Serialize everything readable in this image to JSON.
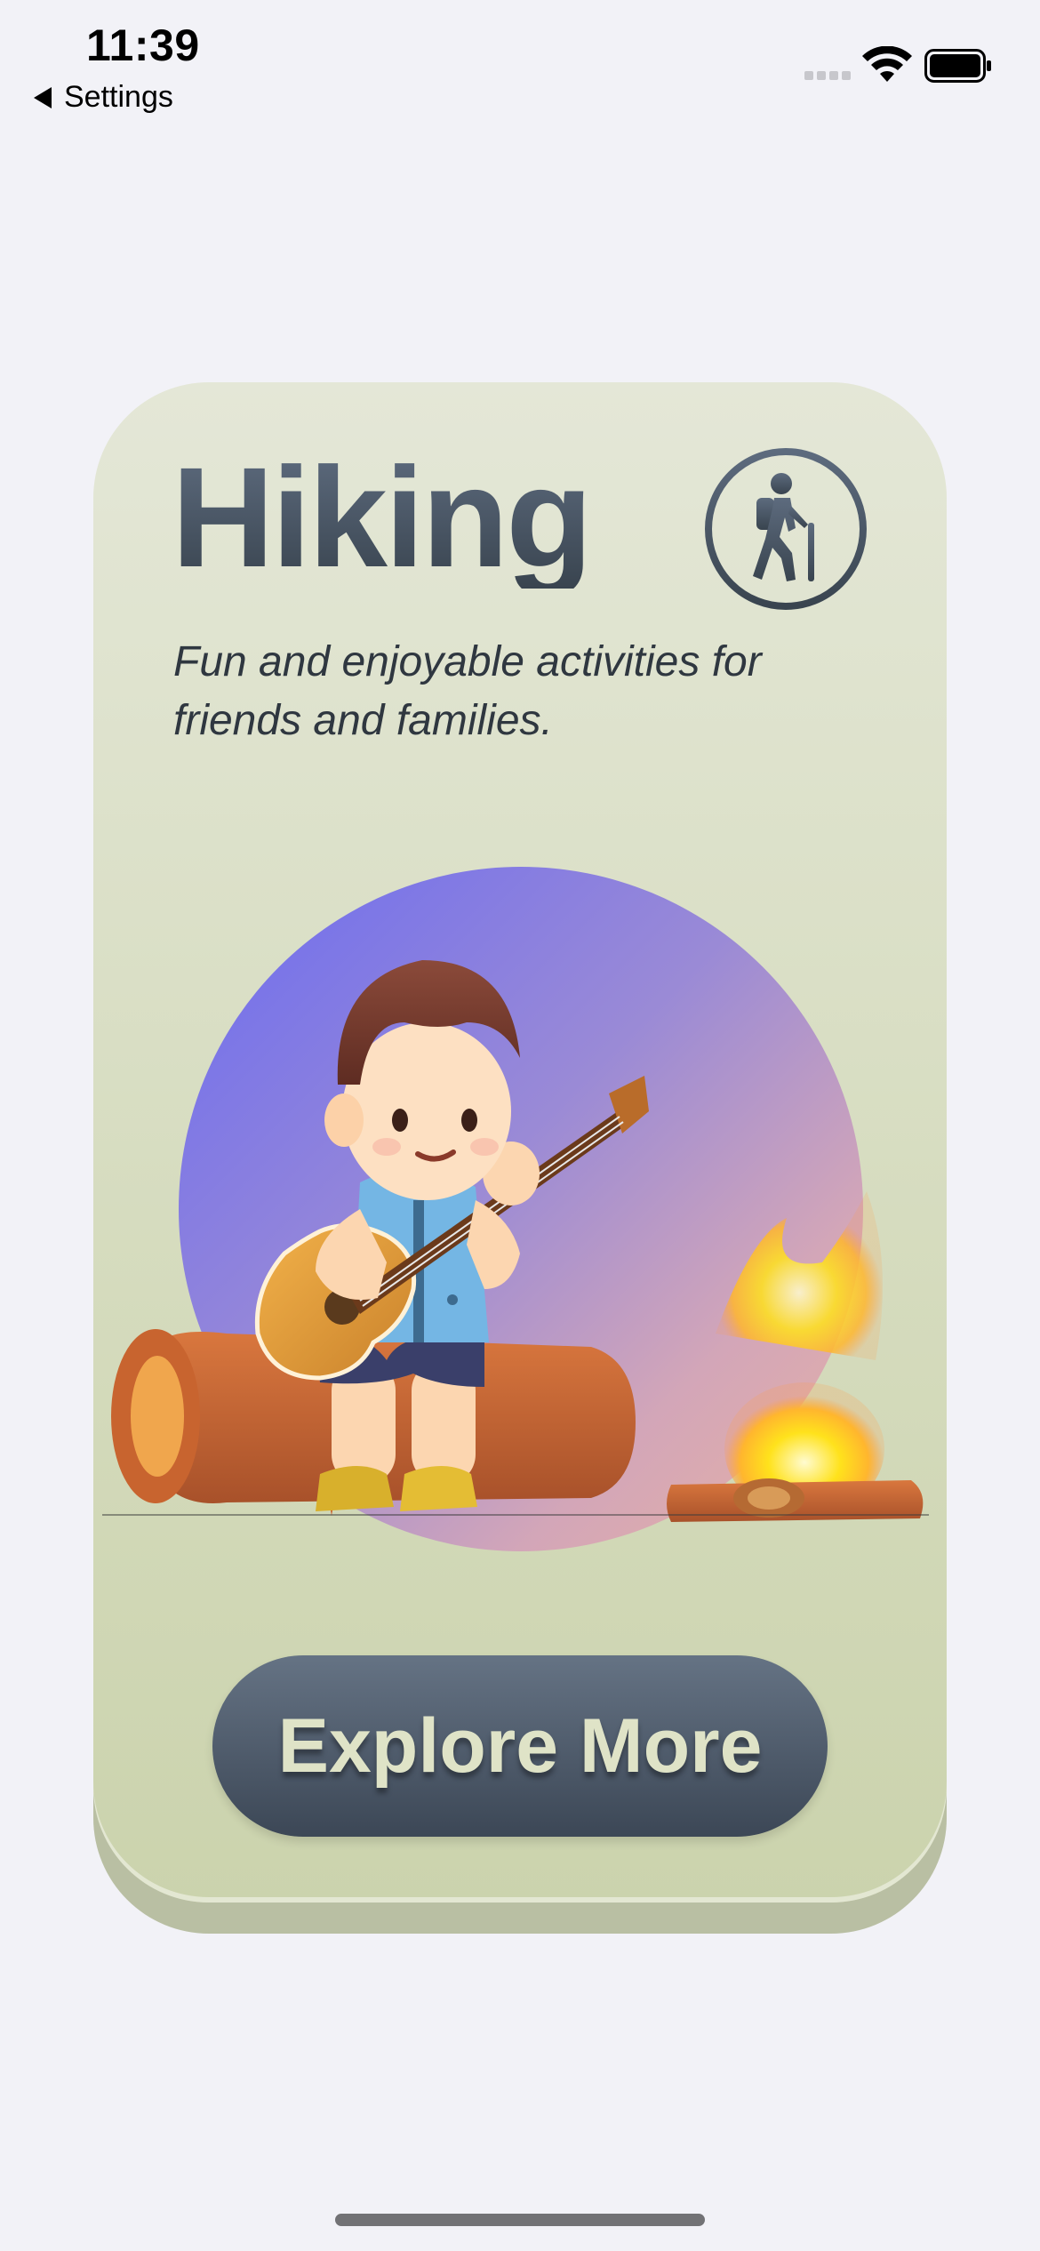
{
  "status_bar": {
    "time": "11:39",
    "back_label": "Settings",
    "icons": [
      "back-arrow-icon",
      "cellular-signal-icon",
      "wifi-icon",
      "battery-icon"
    ]
  },
  "card": {
    "title": "Hiking",
    "subtitle": "Fun and enjoyable activities for friends and families.",
    "badge_icon": "hiker-icon",
    "illustration": "boy-playing-guitar-on-log-by-campfire",
    "button_label": "Explore More"
  },
  "colors": {
    "background": "#f2f2f7",
    "card": "#dbe0c8",
    "title": "#3f4a56",
    "button": "#4a5666",
    "button_text": "#dfe3c7",
    "orb_start": "#6c6cf0",
    "orb_end": "#e8b1a2"
  }
}
